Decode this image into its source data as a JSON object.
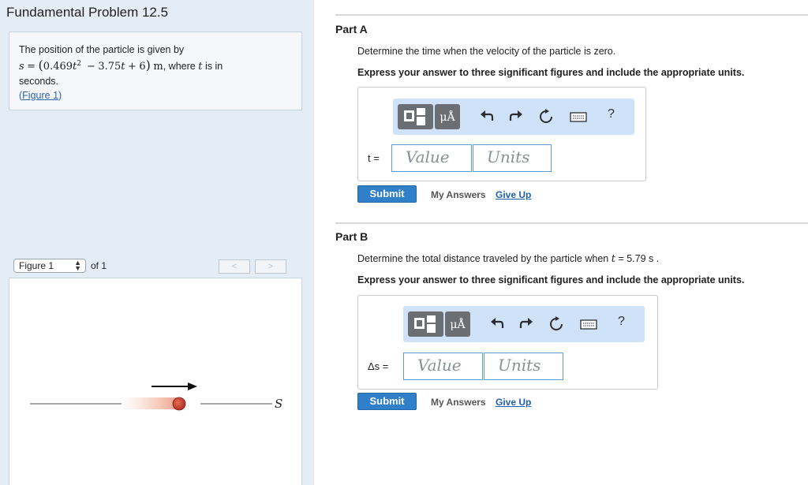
{
  "left": {
    "title": "Fundamental Problem 12.5",
    "problem": {
      "intro": "The position of the particle is given by",
      "formula": {
        "s": "s",
        "eq": "=",
        "lparen": "(",
        "c1": "0.469",
        "t": "t",
        "exp": "2",
        "minus": "−",
        "c2": "3.75",
        "plus": "+",
        "c3": "6",
        "rparen": ")",
        "unit": "m",
        "tail": ", where",
        "t_in": "is in"
      },
      "line3": "seconds.",
      "figure_link_open": "(",
      "figure_link": "Figure 1",
      "figure_link_close": ")"
    },
    "figure": {
      "selected": "Figure 1",
      "of_text": "of 1",
      "prev": "<",
      "next": ">",
      "axis_label": "S"
    }
  },
  "parts": [
    {
      "title": "Part A",
      "question": "Determine the time when the velocity of the particle is zero.",
      "instruction": "Express your answer to three significant figures and include the appropriate units.",
      "var_label": "t =",
      "value_placeholder": "Value",
      "units_placeholder": "Units",
      "submit": "Submit",
      "my_answers": "My Answers",
      "give_up": "Give Up"
    },
    {
      "title": "Part B",
      "question_prefix": "Determine the total distance traveled by the particle when",
      "question_var": "t",
      "question_suffix": "= 5.79 s .",
      "instruction": "Express your answer to three significant figures and include the appropriate units.",
      "var_label": "Δs =",
      "value_placeholder": "Value",
      "units_placeholder": "Units",
      "submit": "Submit",
      "my_answers": "My Answers",
      "give_up": "Give Up"
    }
  ],
  "toolbar": {
    "units_glyph": "μÅ",
    "undo_icon": "undo-icon",
    "redo_icon": "redo-icon",
    "reset_icon": "reset-icon",
    "keyboard_icon": "keyboard-icon",
    "help": "?"
  },
  "colors": {
    "left_bg": "#e4ecf6",
    "toolbar_bg": "#cfe2f7",
    "submit_bg": "#2f7fc9",
    "input_border": "#5b9bd5",
    "ball": "#d44a3a"
  }
}
